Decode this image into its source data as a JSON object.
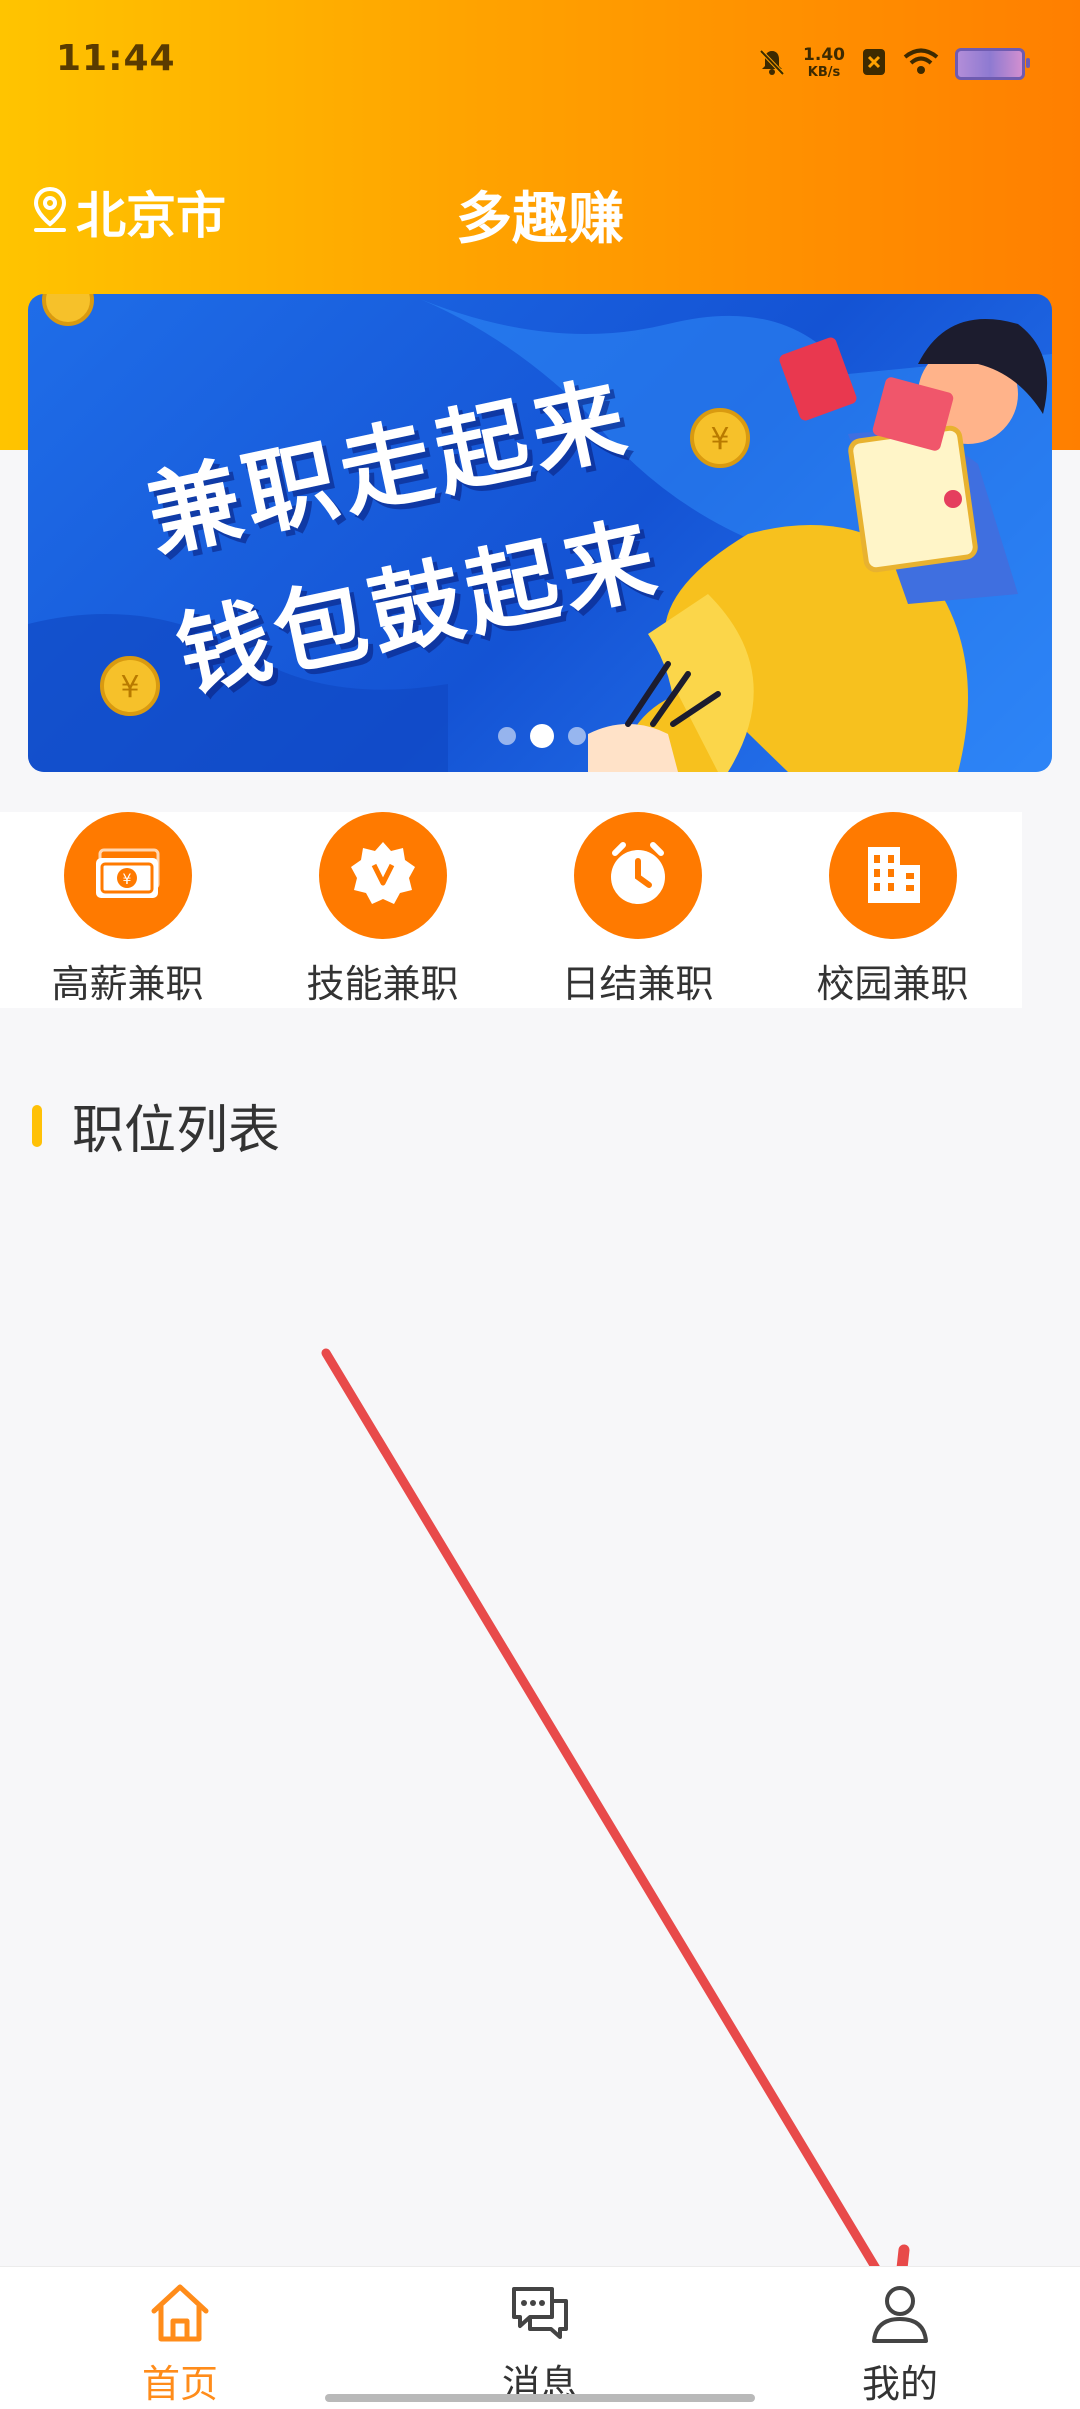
{
  "status_bar": {
    "time": "11:44",
    "net_speed_value": "1.40",
    "net_speed_unit": "KB/s",
    "icons": [
      "bell-muted-icon",
      "sim-blocked-icon",
      "wifi-icon",
      "battery-icon"
    ]
  },
  "header": {
    "location": "北京市",
    "title": "多趣赚",
    "location_icon": "location-pin-icon"
  },
  "banner": {
    "line1": "兼职走起来",
    "line2": "钱包鼓起来",
    "slide_count": 3,
    "active_slide": 1
  },
  "categories": [
    {
      "label": "高薪兼职",
      "icon": "money-icon"
    },
    {
      "label": "技能兼职",
      "icon": "badge-icon"
    },
    {
      "label": "日结兼职",
      "icon": "clock-icon"
    },
    {
      "label": "校园兼职",
      "icon": "building-icon"
    }
  ],
  "section": {
    "title": "职位列表"
  },
  "tabbar": {
    "items": [
      {
        "label": "首页",
        "icon": "home-icon",
        "active": true
      },
      {
        "label": "消息",
        "icon": "chat-icon",
        "active": false
      },
      {
        "label": "我的",
        "icon": "user-icon",
        "active": false
      }
    ]
  },
  "colors": {
    "accent": "#ff8c1a",
    "category_icon_bg": "#ff7a00",
    "section_marker": "#ffc107",
    "banner_blue": "#1a5fe0",
    "annotation_arrow": "#e84a4a"
  }
}
